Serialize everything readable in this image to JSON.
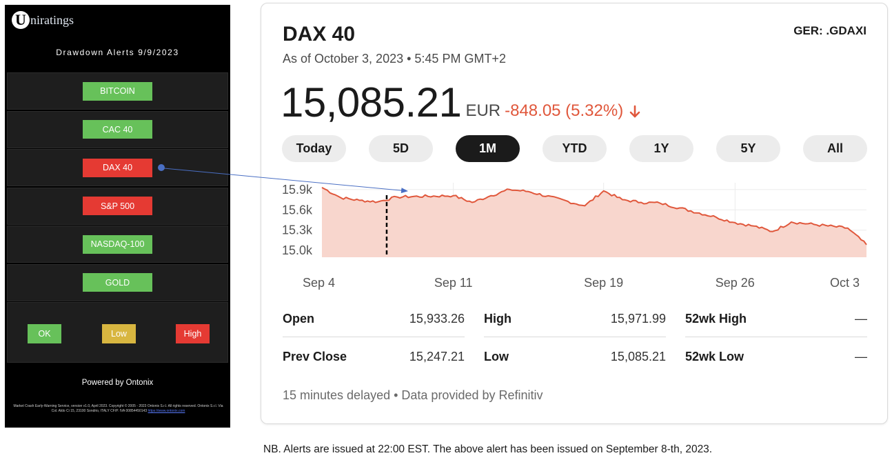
{
  "app": {
    "brand_letter": "U",
    "brand_rest": "niratings",
    "alerts_title": "Drawdown Alerts 9/9/2023",
    "alerts": [
      {
        "label": "BITCOIN",
        "status": "ok"
      },
      {
        "label": "CAC 40",
        "status": "ok"
      },
      {
        "label": "DAX 40",
        "status": "high"
      },
      {
        "label": "S&P 500",
        "status": "high"
      },
      {
        "label": "NASDAQ-100",
        "status": "ok"
      },
      {
        "label": "GOLD",
        "status": "ok"
      }
    ],
    "legend": {
      "ok": "OK",
      "low": "Low",
      "high": "High"
    },
    "status_colors": {
      "ok": "#67c15a",
      "low": "#d8b640",
      "high": "#e53a33"
    },
    "powered_by": "Powered by Ontonix",
    "footnote_text": "Market Crash Early-Warning Service, version v1.0, April 2023. Copyright © 2005 - 2023 Ontonix S.r.l. All rights reserved. Ontonix S.r.l. Via Col. Aldo Ci 15, 23100 Sondrio, ITALY CF/P. IVA 00854450143",
    "footnote_link": "https://www.ontonix.com"
  },
  "quote": {
    "name": "DAX 40",
    "ticker": "GER: .GDAXI",
    "as_of": "As of October 3, 2023 • 5:45 PM GMT+2",
    "price": "15,085.21",
    "currency": "EUR",
    "change": "-848.05 (5.32%)",
    "change_color": "#e0573b",
    "ranges": [
      {
        "label": "Today",
        "active": false
      },
      {
        "label": "5D",
        "active": false
      },
      {
        "label": "1M",
        "active": true
      },
      {
        "label": "YTD",
        "active": false
      },
      {
        "label": "1Y",
        "active": false
      },
      {
        "label": "5Y",
        "active": false
      },
      {
        "label": "All",
        "active": false
      }
    ],
    "stats": [
      {
        "label": "Open",
        "value": "15,933.26"
      },
      {
        "label": "High",
        "value": "15,971.99"
      },
      {
        "label": "52wk High",
        "value": "—"
      },
      {
        "label": "Prev Close",
        "value": "15,247.21"
      },
      {
        "label": "Low",
        "value": "15,085.21"
      },
      {
        "label": "52wk Low",
        "value": "—"
      }
    ],
    "disclaimer": "15 minutes delayed • Data provided by Refinitiv"
  },
  "chart_data": {
    "type": "area",
    "y_ticks": [
      "15.9k",
      "15.6k",
      "15.3k",
      "15.0k"
    ],
    "x_ticks": [
      "Sep 4",
      "Sep 11",
      "Sep 19",
      "Sep 26",
      "Oct 3"
    ],
    "ylim": [
      14900,
      16000
    ],
    "line_color": "#e0573b",
    "fill_color": "#f8d6cd",
    "grid": true,
    "x": [
      "Sep 4",
      "Sep 5",
      "Sep 6",
      "Sep 7",
      "Sep 8",
      "Sep 11",
      "Sep 12",
      "Sep 13",
      "Sep 14",
      "Sep 15",
      "Sep 18",
      "Sep 19",
      "Sep 20",
      "Sep 21",
      "Sep 22",
      "Sep 25",
      "Sep 26",
      "Sep 27",
      "Sep 28",
      "Sep 29",
      "Oct 2",
      "Oct 3"
    ],
    "values": [
      15930,
      15780,
      15740,
      15720,
      15790,
      15810,
      15710,
      15810,
      15900,
      15870,
      15660,
      15880,
      15750,
      15710,
      15700,
      15490,
      15410,
      15360,
      15280,
      15420,
      15330,
      15085
    ]
  },
  "annotation": {
    "marker_date": "Sep 8",
    "note": "NB. Alerts are issued at 22:00 EST. The above alert has been issued on September 8-th, 2023.",
    "arrow_color": "#4a6fc4"
  }
}
